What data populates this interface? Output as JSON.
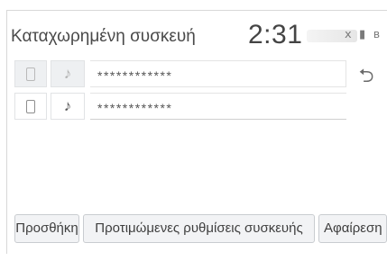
{
  "header": {
    "title": "Καταχωρημένη συσκευή",
    "clock": "2:31",
    "status_icons": [
      "battery-icon",
      "bluetooth-icon"
    ],
    "battery_glyph": "▮",
    "bluetooth_glyph": "ʙ",
    "signal_glyph": "ⅹ"
  },
  "devices": [
    {
      "name": "************",
      "phone_icon": "phone-icon",
      "music_icon": "music-note-icon",
      "note_glyph": "♪"
    },
    {
      "name": "************",
      "phone_icon": "phone-icon",
      "music_icon": "music-note-icon",
      "note_glyph": "♪"
    }
  ],
  "back": {
    "icon": "return-arrow-icon",
    "glyph": "⮌"
  },
  "buttons": {
    "add": "Προσθήκη",
    "preferences": "Προτιμώμενες ρυθμίσεις συσκευής",
    "remove": "Αφαίρεση"
  }
}
